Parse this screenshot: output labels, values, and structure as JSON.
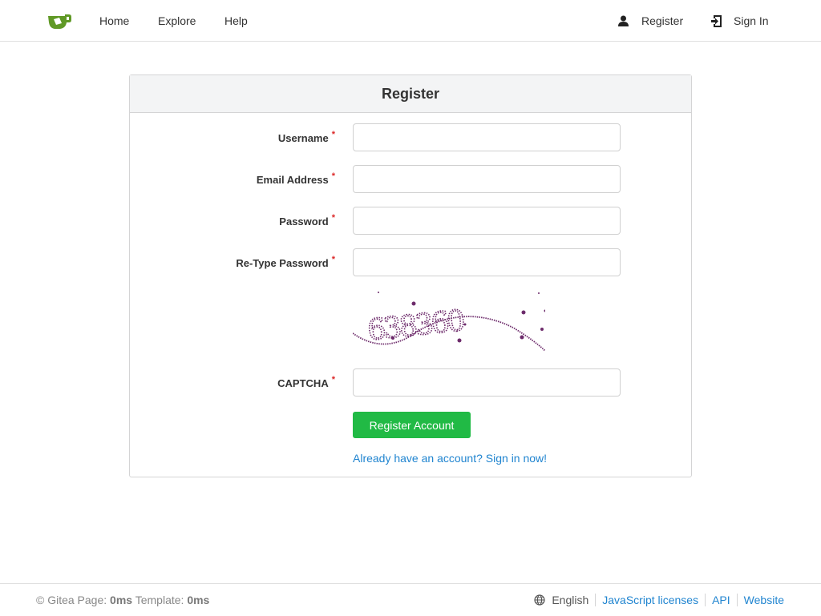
{
  "nav": {
    "home": "Home",
    "explore": "Explore",
    "help": "Help",
    "register": "Register",
    "sign_in": "Sign In"
  },
  "form": {
    "title": "Register",
    "required_mark": "*",
    "username_label": "Username",
    "email_label": "Email Address",
    "password_label": "Password",
    "retype_label": "Re-Type Password",
    "captcha_label": "CAPTCHA",
    "captcha_text": "638360",
    "submit_label": "Register Account",
    "signin_link": "Already have an account? Sign in now!",
    "username_value": "",
    "email_value": "",
    "password_value": "",
    "retype_value": "",
    "captcha_value": ""
  },
  "footer": {
    "prefix": "© Gitea Page:",
    "page_time": "0ms",
    "template_label": "Template:",
    "template_time": "0ms",
    "language": "English",
    "js_licenses": "JavaScript licenses",
    "api": "API",
    "website": "Website"
  },
  "colors": {
    "brand": "#609926",
    "primary_button": "#21ba45",
    "link": "#2185d0",
    "required": "#db2828",
    "captcha_ink": "#6d2b6b"
  },
  "icons": {
    "logo": "gitea-logo-icon",
    "register": "person-icon",
    "sign_in": "sign-in-icon",
    "language": "globe-icon"
  }
}
